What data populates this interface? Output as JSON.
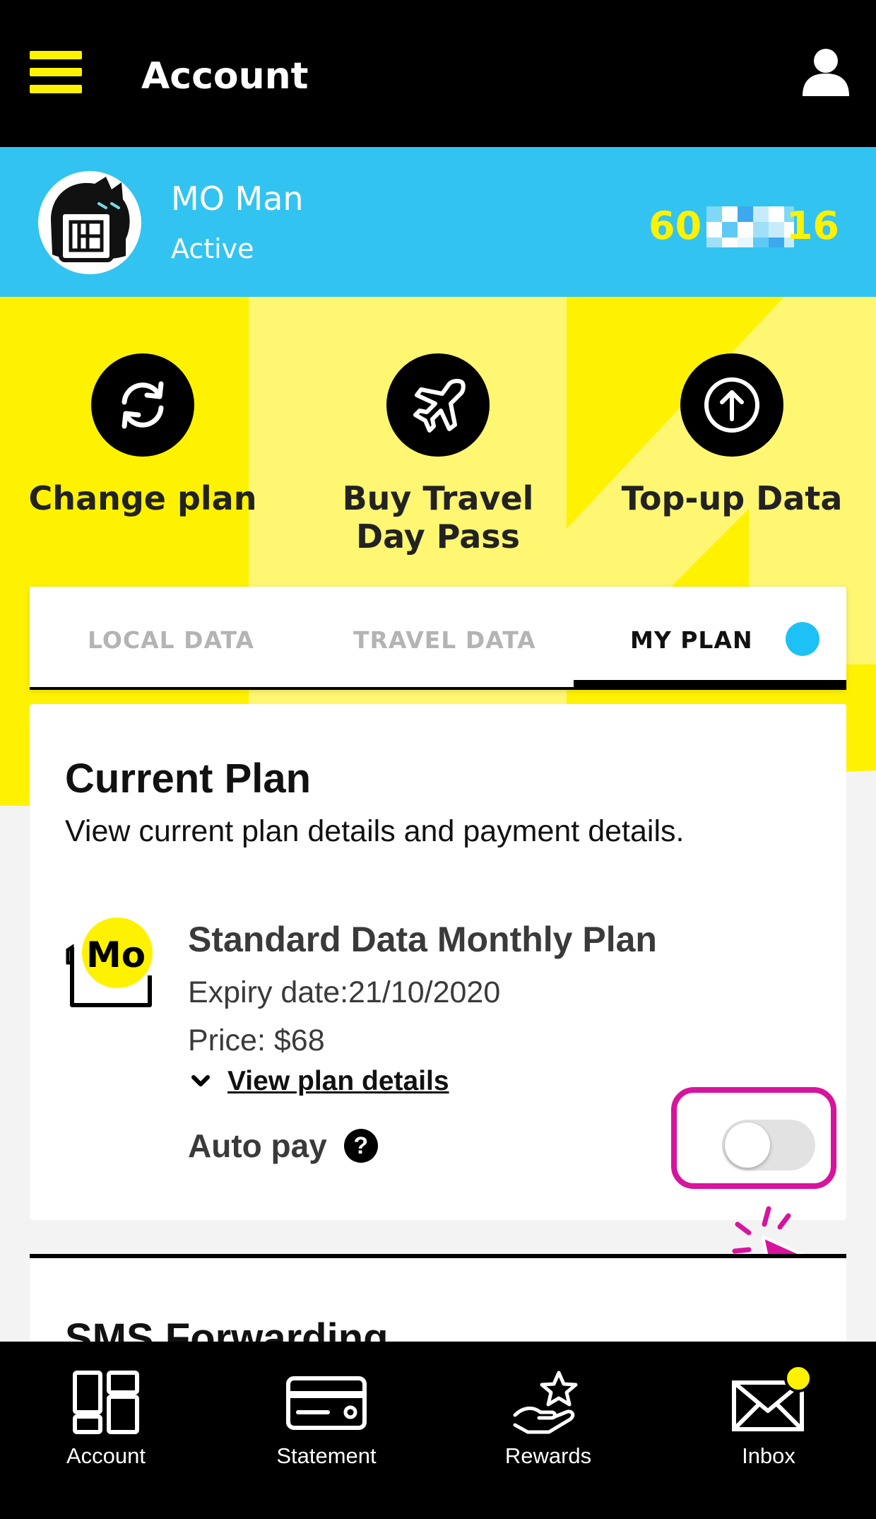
{
  "header": {
    "title": "Account",
    "menu_icon": "hamburger-icon",
    "profile_icon": "user-icon"
  },
  "profile": {
    "name": "MO Man",
    "status": "Active",
    "number_prefix": "60",
    "number_suffix": "16"
  },
  "actions": [
    {
      "label": "Change plan",
      "icon": "refresh-icon"
    },
    {
      "label": "Buy Travel Day Pass",
      "icon": "airplane-icon"
    },
    {
      "label": "Top-up Data",
      "icon": "arrow-up-circle-icon"
    }
  ],
  "tabs": [
    {
      "label": "LOCAL DATA",
      "active": false
    },
    {
      "label": "TRAVEL DATA",
      "active": false
    },
    {
      "label": "MY PLAN",
      "active": true
    }
  ],
  "current_plan": {
    "heading": "Current Plan",
    "subtitle": "View current plan details and payment details.",
    "plan_name": "Standard Data Monthly Plan",
    "expiry": "Expiry date:21/10/2020",
    "price": "Price: $68",
    "details_link": "View plan details",
    "autopay_label": "Auto pay",
    "autopay_enabled": false,
    "help_symbol": "?",
    "logo_text": "Mo"
  },
  "sms_forwarding": {
    "heading": "SMS Forwarding"
  },
  "bottom_nav": [
    {
      "label": "Account",
      "icon": "dashboard-icon"
    },
    {
      "label": "Statement",
      "icon": "card-icon"
    },
    {
      "label": "Rewards",
      "icon": "hand-star-icon"
    },
    {
      "label": "Inbox",
      "icon": "envelope-icon"
    }
  ],
  "colors": {
    "yellow": "#fff200",
    "blue": "#33c3f0",
    "highlight": "#d6149c",
    "black": "#000000"
  }
}
